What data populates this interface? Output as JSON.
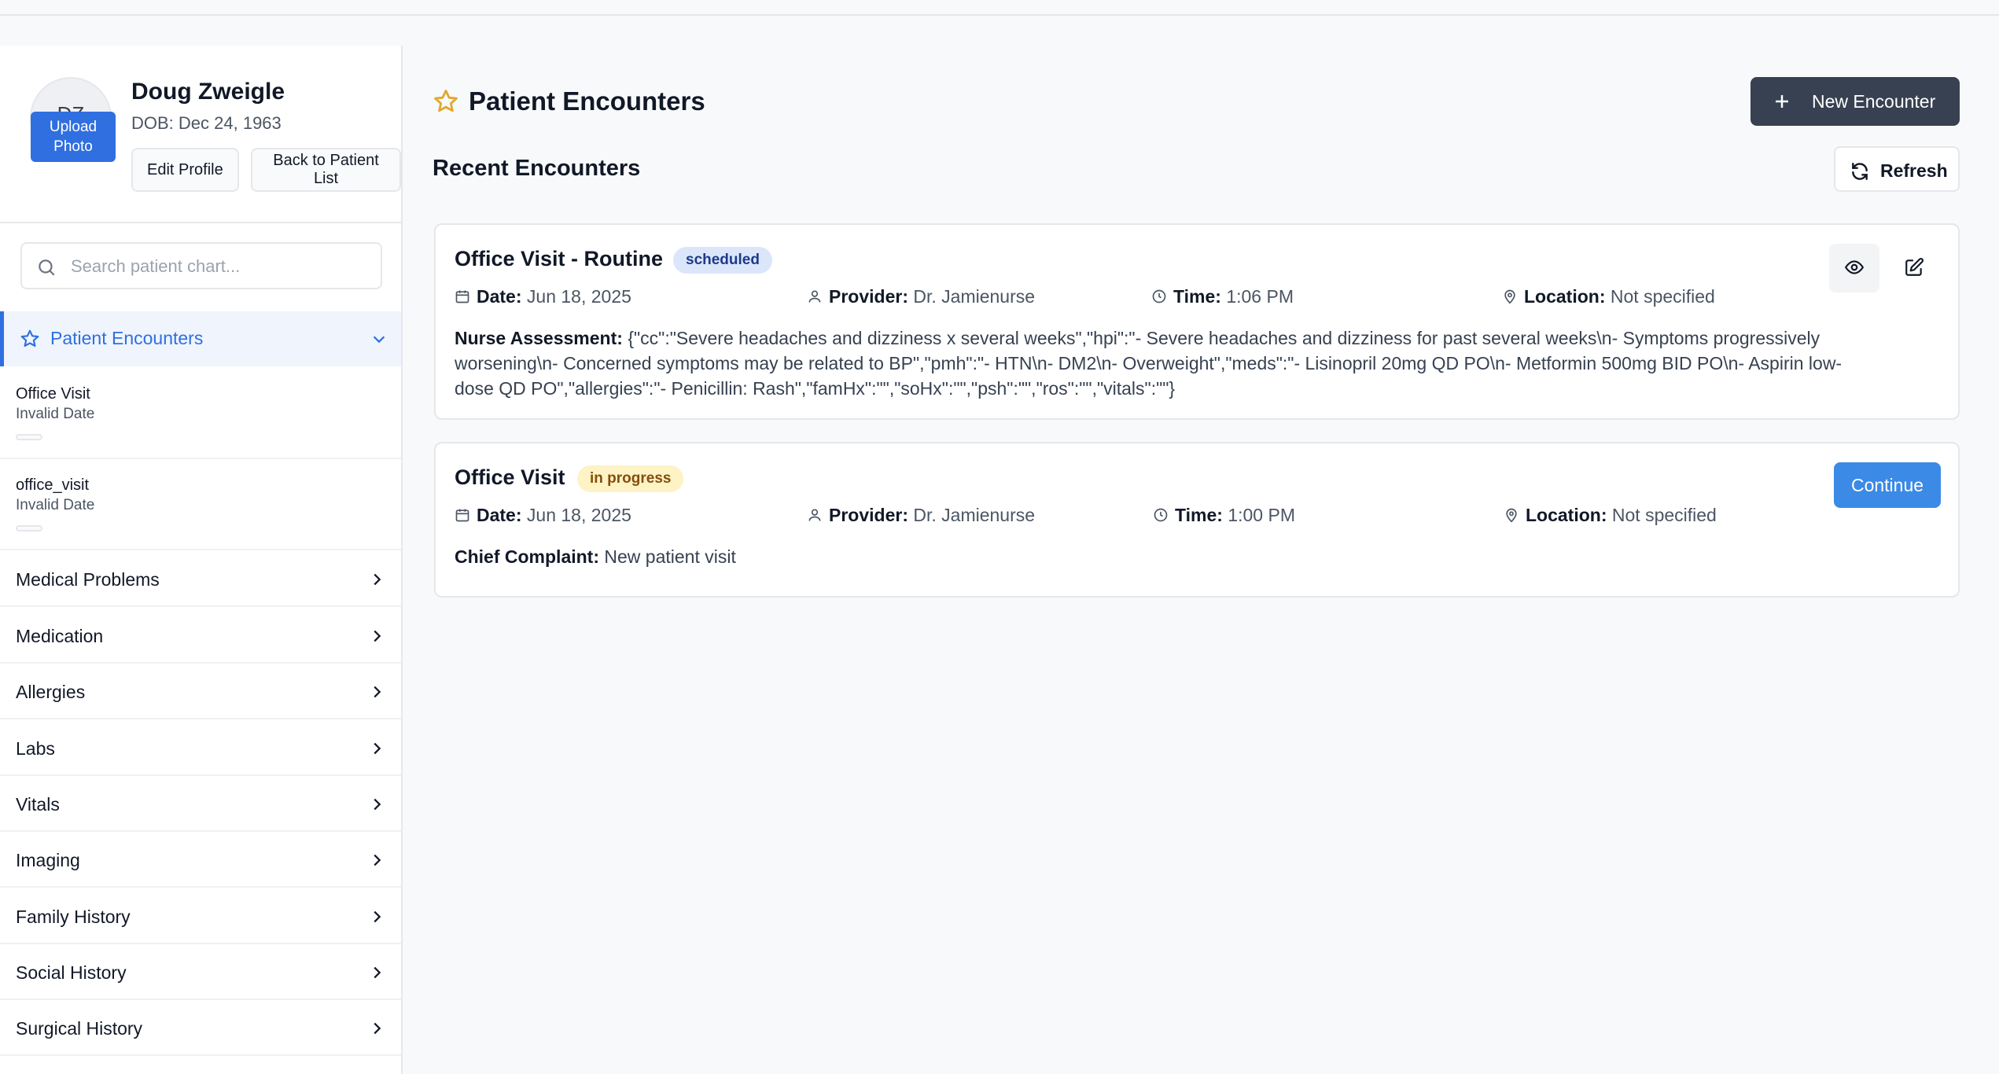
{
  "patient": {
    "initials": "DZ",
    "name": "Doug Zweigle",
    "dob": "DOB: Dec 24, 1963",
    "upload_photo": "Upload Photo",
    "edit_profile": "Edit Profile",
    "back_to_list": "Back to Patient List"
  },
  "search": {
    "placeholder": "Search patient chart..."
  },
  "sidebar": {
    "active_section": "Patient Encounters",
    "encounters": [
      {
        "title": "Office Visit",
        "date": "Invalid Date"
      },
      {
        "title": "office_visit",
        "date": "Invalid Date"
      }
    ],
    "sections": [
      "Medical Problems",
      "Medication",
      "Allergies",
      "Labs",
      "Vitals",
      "Imaging",
      "Family History",
      "Social History",
      "Surgical History"
    ]
  },
  "main": {
    "title": "Patient Encounters",
    "new_encounter": "New Encounter",
    "recent_title": "Recent Encounters",
    "refresh": "Refresh"
  },
  "encounters": [
    {
      "title": "Office Visit - Routine",
      "status": "scheduled",
      "date_label": "Date:",
      "date": "Jun 18, 2025",
      "provider_label": "Provider:",
      "provider": "Dr. Jamienurse",
      "time_label": "Time:",
      "time": "1:06 PM",
      "location_label": "Location:",
      "location": "Not specified",
      "note_label": "Nurse Assessment:",
      "note": "{\"cc\":\"Severe headaches and dizziness x several weeks\",\"hpi\":\"- Severe headaches and dizziness for past several weeks\\n- Symptoms progressively worsening\\n- Concerned symptoms may be related to BP\",\"pmh\":\"- HTN\\n- DM2\\n- Overweight\",\"meds\":\"- Lisinopril 20mg QD PO\\n- Metformin 500mg BID PO\\n- Aspirin low-dose QD PO\",\"allergies\":\"- Penicillin: Rash\",\"famHx\":\"\",\"soHx\":\"\",\"psh\":\"\",\"ros\":\"\",\"vitals\":\"\"}"
    },
    {
      "title": "Office Visit",
      "status": "in progress",
      "date_label": "Date:",
      "date": "Jun 18, 2025",
      "provider_label": "Provider:",
      "provider": "Dr. Jamienurse",
      "time_label": "Time:",
      "time": "1:00 PM",
      "location_label": "Location:",
      "location": "Not specified",
      "note_label": "Chief Complaint:",
      "note": "New patient visit",
      "action": "Continue"
    }
  ],
  "colors": {
    "accent": "#2f6fe0",
    "primary_dark": "#374151",
    "scheduled_badge_bg": "#dbe6fb",
    "scheduled_badge_text": "#1e3a8a",
    "in_progress_badge_bg": "#fdf3c4",
    "in_progress_badge_text": "#854d0e",
    "star": "#e0a82e"
  },
  "icons": [
    "star-icon",
    "plus-icon",
    "refresh-icon",
    "search-icon",
    "chevron-down-icon",
    "chevron-right-icon",
    "calendar-icon",
    "user-icon",
    "clock-icon",
    "map-pin-icon",
    "eye-icon",
    "edit-icon"
  ]
}
